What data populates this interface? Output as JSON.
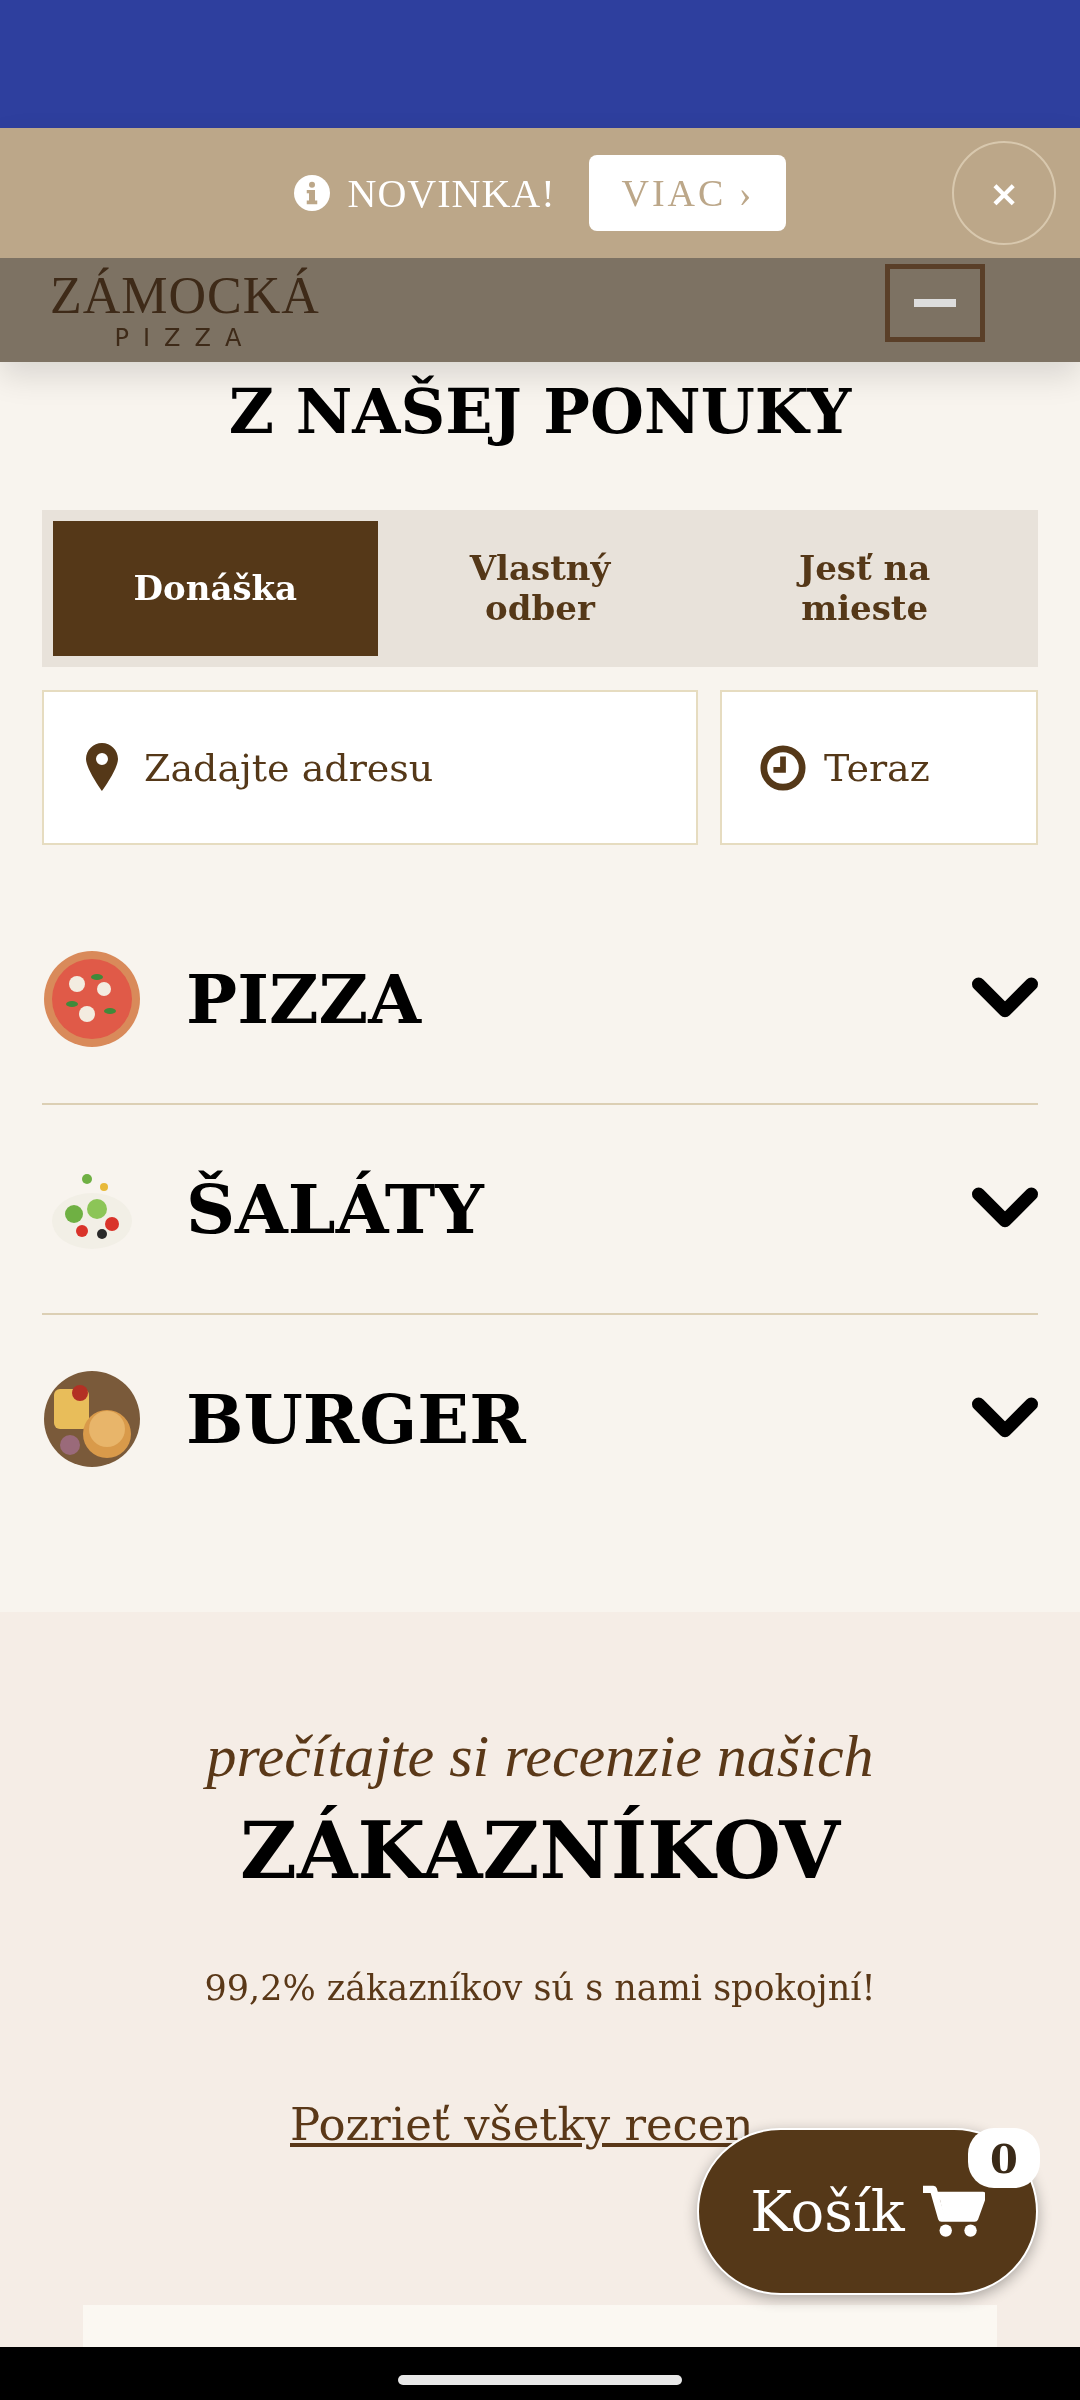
{
  "banner": {
    "label": "NOVINKA!",
    "button": "VIAC ›",
    "close": "×"
  },
  "header": {
    "logo": "ZÁMOCKÁ",
    "logo_sub": "PIZZA"
  },
  "heading": "Z NAŠEJ PONUKY",
  "tabs": [
    {
      "label": "Donáška",
      "selected": true
    },
    {
      "label": "Vlastný odber",
      "selected": false
    },
    {
      "label": "Jesť na mieste",
      "selected": false
    }
  ],
  "address": {
    "placeholder": "Zadajte adresu"
  },
  "time": {
    "value": "Teraz"
  },
  "categories": [
    {
      "name": "PIZZA"
    },
    {
      "name": "ŠALÁTY"
    },
    {
      "name": "BURGER"
    }
  ],
  "reviews": {
    "kicker": "prečítajte si recenzie našich",
    "title": "ZÁKAZNÍKOV",
    "stat": "99,2% zákazníkov sú s nami spokojní!",
    "link": "Pozrieť všetky recen"
  },
  "cart": {
    "label": "Košík",
    "count": "0"
  }
}
